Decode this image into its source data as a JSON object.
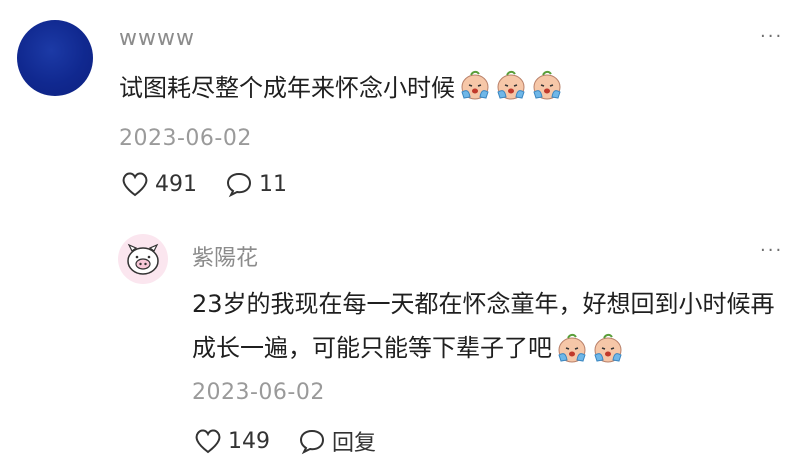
{
  "main_comment": {
    "username": "wwww",
    "text": "试图耗尽整个成年来怀念小时候",
    "emoji_count": 3,
    "emoji_name": "crying-face-emoji",
    "date": "2023-06-02",
    "likes": "491",
    "replies": "11",
    "more_label": "···"
  },
  "reply": {
    "username": "紫陽花",
    "text": "23岁的我现在每一天都在怀念童年，好想回到小时候再成长一遍，可能只能等下辈子了吧",
    "emoji_count": 2,
    "date": "2023-06-02",
    "likes": "149",
    "reply_label": "回复",
    "more_label": "···"
  },
  "colors": {
    "main_avatar": "#10288f",
    "reply_avatar_bg": "#fbe6ef",
    "text": "#1f1f1f",
    "muted": "#9a9a9a"
  }
}
